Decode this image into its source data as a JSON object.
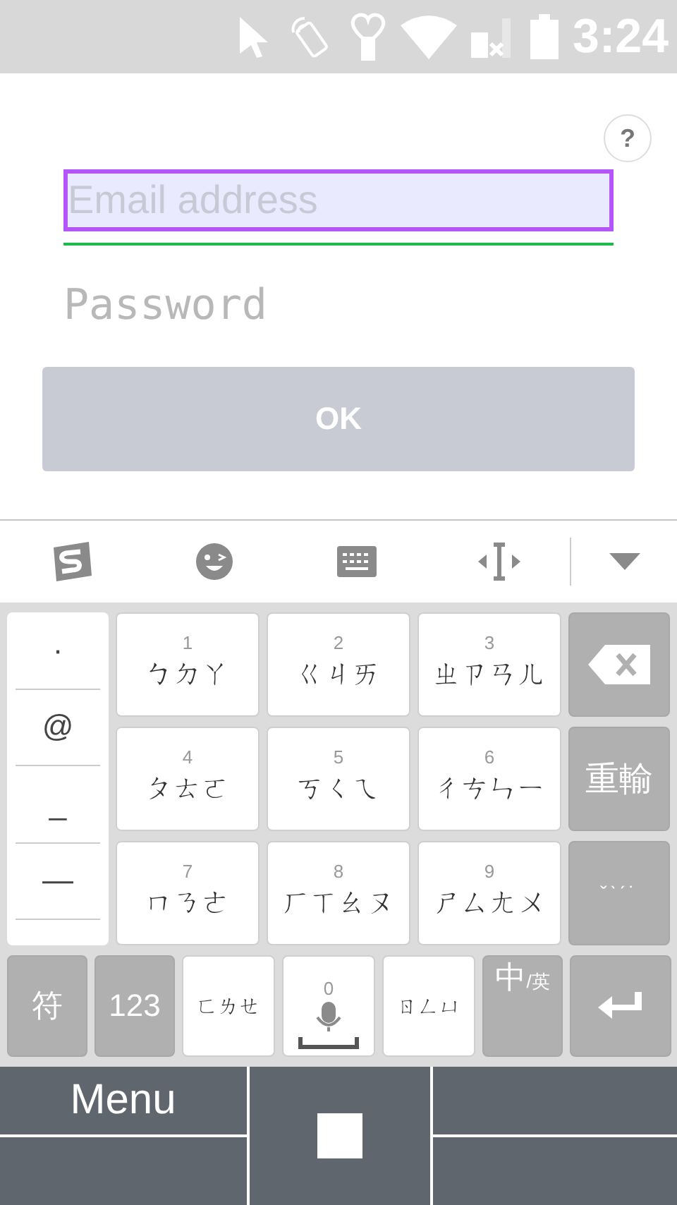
{
  "status_bar": {
    "time": "3:24"
  },
  "help_button": {
    "label": "?"
  },
  "form": {
    "email": {
      "placeholder": "Email address",
      "focused": true
    },
    "password": {
      "placeholder": "Password",
      "focused": false
    },
    "ok_button": {
      "label": "OK",
      "disabled": true
    }
  },
  "keyboard": {
    "symbols": [
      "·",
      "@",
      "_",
      "—"
    ],
    "keys": [
      {
        "digit": "1",
        "label": "ㄅㄉㄚ"
      },
      {
        "digit": "2",
        "label": "ㄍㄐㄞ"
      },
      {
        "digit": "3",
        "label": "ㄓㄗㄢㄦ"
      },
      {
        "digit": "4",
        "label": "ㄆㄊㄛ"
      },
      {
        "digit": "5",
        "label": "ㄎㄑㄟ"
      },
      {
        "digit": "6",
        "label": "ㄔㄘㄣㄧ"
      },
      {
        "digit": "7",
        "label": "ㄇㄋㄜ"
      },
      {
        "digit": "8",
        "label": "ㄏㄒㄠㄡ"
      },
      {
        "digit": "9",
        "label": "ㄕㄙㄤㄨ"
      }
    ],
    "side_keys": [
      {
        "kind": "backspace"
      },
      {
        "kind": "text",
        "label": "重輸"
      },
      {
        "kind": "tones",
        "label": "ˇˋˊ˙"
      }
    ],
    "bottom_row": [
      {
        "kind": "function",
        "label": "符"
      },
      {
        "kind": "function",
        "label": "123"
      },
      {
        "kind": "letter",
        "label": "ㄈㄌㄝ"
      },
      {
        "kind": "space",
        "digit": "0"
      },
      {
        "kind": "letter",
        "label": "ㄖㄥㄩ"
      },
      {
        "kind": "lang",
        "label": "中",
        "sub": "/英"
      },
      {
        "kind": "enter"
      }
    ]
  },
  "nav_bar": {
    "menu_label": "Menu"
  }
}
